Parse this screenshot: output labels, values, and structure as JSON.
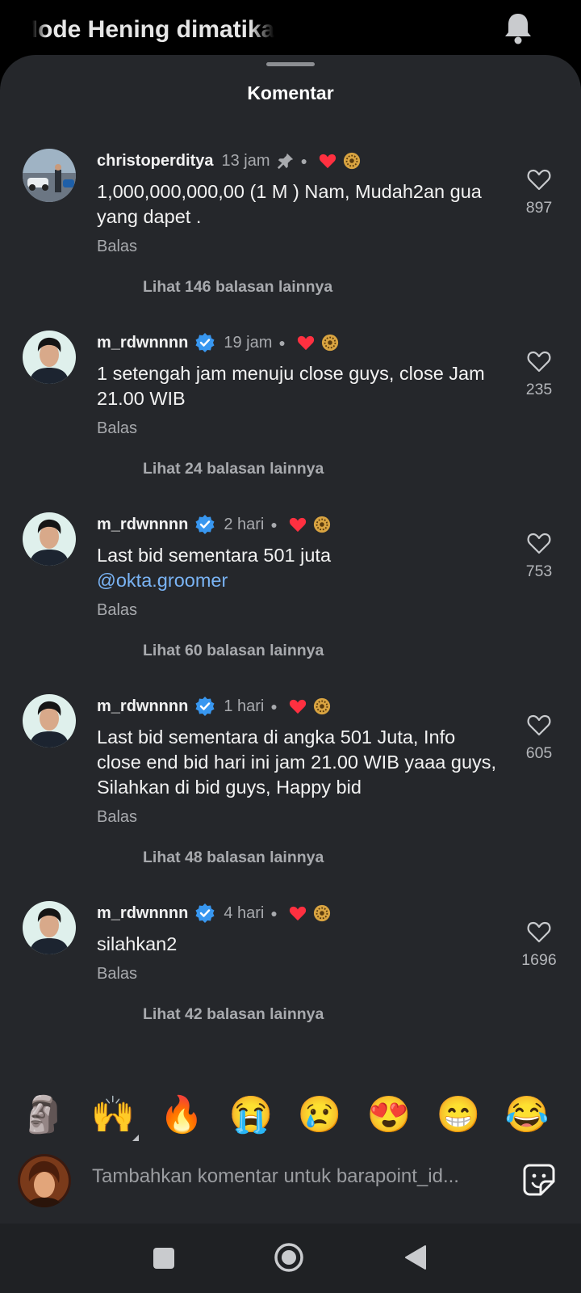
{
  "status_bar": {
    "notification_text": "Mode Hening dimatikan",
    "bell_icon": "bell-icon"
  },
  "sheet": {
    "title": "Komentar"
  },
  "comments": [
    {
      "username": "christoperditya",
      "time": "13 jam",
      "pinned": true,
      "verified": false,
      "text": "1,000,000,000,00 (1 M ) Nam, Mudah2an gua yang dapet .",
      "mention": "",
      "reply_label": "Balas",
      "more_replies": "Lihat 146 balasan lainnya",
      "likes": "897"
    },
    {
      "username": "m_rdwnnnn",
      "time": "19 jam",
      "pinned": false,
      "verified": true,
      "text": "1 setengah jam menuju close guys, close Jam 21.00 WIB",
      "mention": "",
      "reply_label": "Balas",
      "more_replies": "Lihat 24 balasan lainnya",
      "likes": "235"
    },
    {
      "username": "m_rdwnnnn",
      "time": "2 hari",
      "pinned": false,
      "verified": true,
      "text": "Last bid sementara 501 juta",
      "mention": "@okta.groomer",
      "reply_label": "Balas",
      "more_replies": "Lihat 60 balasan lainnya",
      "likes": "753"
    },
    {
      "username": "m_rdwnnnn",
      "time": "1 hari",
      "pinned": false,
      "verified": true,
      "text": "Last bid sementara di angka 501 Juta, Info close end bid hari ini jam 21.00 WIB yaaa guys, Silahkan di bid guys, Happy bid",
      "mention": "",
      "reply_label": "Balas",
      "more_replies": "Lihat 48 balasan lainnya",
      "likes": "605"
    },
    {
      "username": "m_rdwnnnn",
      "time": "4 hari",
      "pinned": false,
      "verified": true,
      "text": "silahkan2",
      "mention": "",
      "reply_label": "Balas",
      "more_replies": "Lihat 42 balasan lainnya",
      "likes": "1696"
    }
  ],
  "quick_emojis": [
    "🗿",
    "🙌",
    "🔥",
    "😭",
    "😢",
    "😍",
    "😁",
    "😂"
  ],
  "composer": {
    "placeholder": "Tambahkan komentar untuk barapoint_id...",
    "sticker_icon": "sticker-icon"
  },
  "colors": {
    "background": "#25272b",
    "like_red": "#ff3040",
    "verified_blue": "#3897f0",
    "mention_blue": "#7ab4f5"
  }
}
